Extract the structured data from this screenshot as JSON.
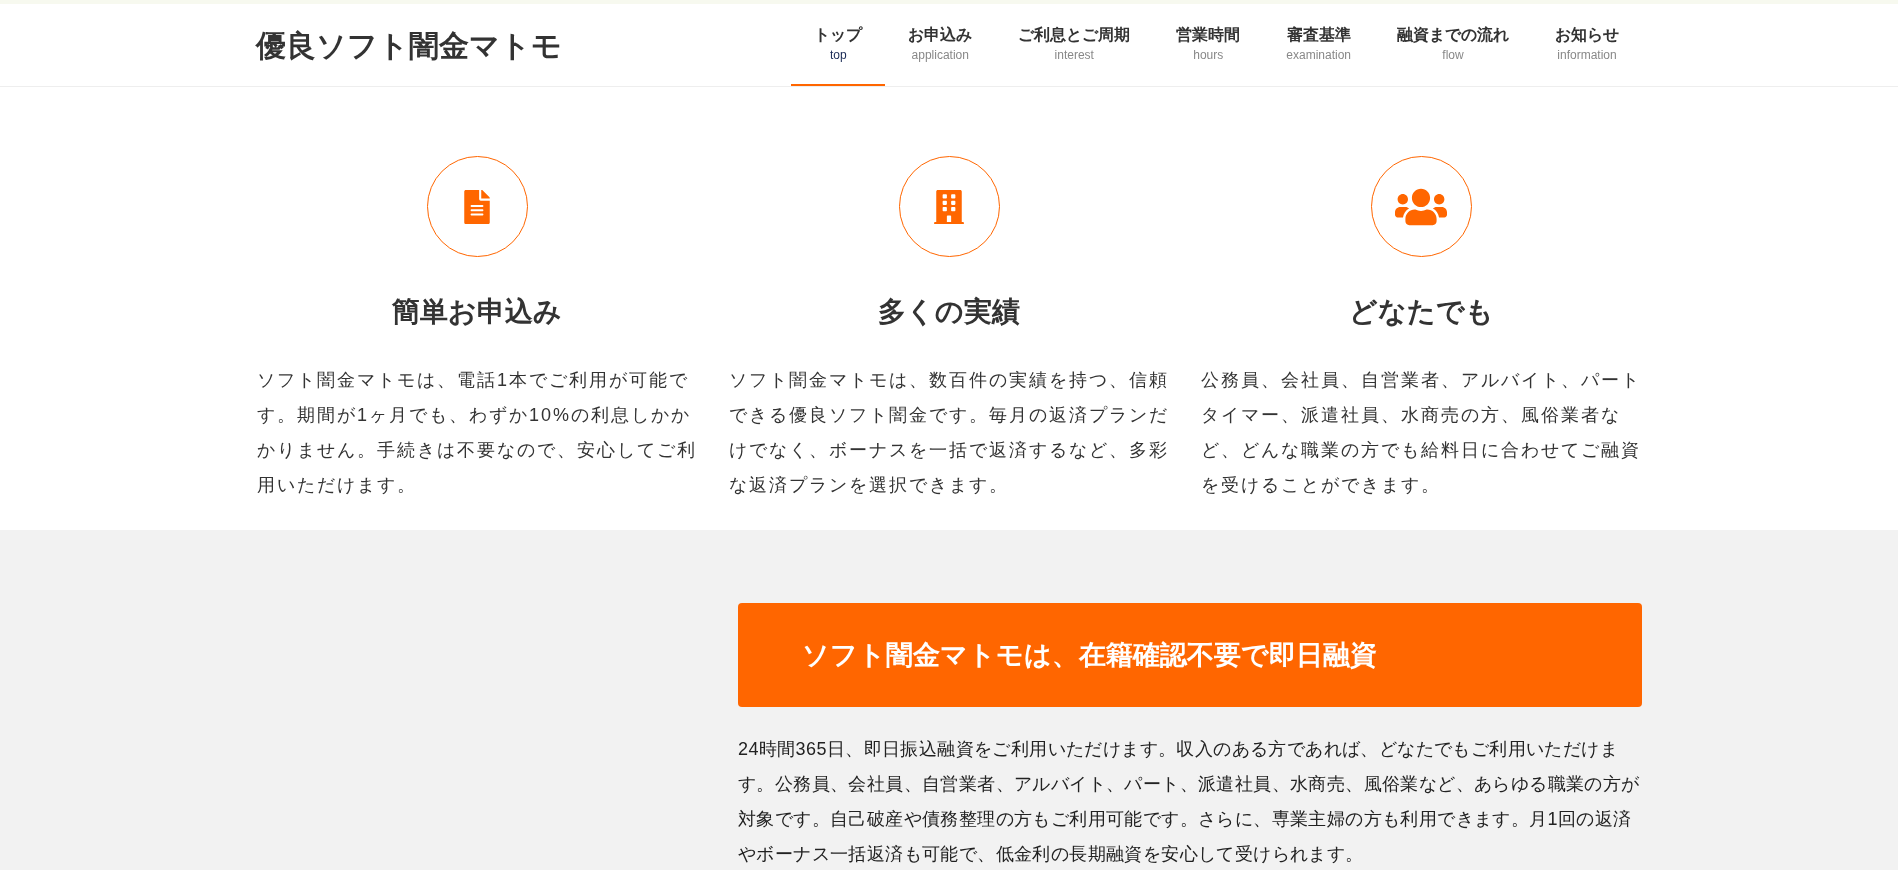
{
  "header": {
    "logo": "優良ソフト闇金マトモ",
    "nav": [
      {
        "label": "トップ",
        "sub": "top",
        "selected": true
      },
      {
        "label": "お申込み",
        "sub": "application",
        "selected": false
      },
      {
        "label": "ご利息とご周期",
        "sub": "interest",
        "selected": false
      },
      {
        "label": "営業時間",
        "sub": "hours",
        "selected": false
      },
      {
        "label": "審査基準",
        "sub": "examination",
        "selected": false
      },
      {
        "label": "融資までの流れ",
        "sub": "flow",
        "selected": false
      },
      {
        "label": "お知らせ",
        "sub": "information",
        "selected": false
      }
    ]
  },
  "features": [
    {
      "kind": "document",
      "title": "簡単お申込み",
      "text": "ソフト闇金マトモは、電話1本でご利用が可能です。期間が1ヶ月でも、わずか10%の利息しかかかりません。手続きは不要なので、安心してご利用いただけます。"
    },
    {
      "kind": "building",
      "title": "多くの実績",
      "text": "ソフト闇金マトモは、数百件の実績を持つ、信頼できる優良ソフト闇金です。毎月の返済プランだけでなく、ボーナスを一括で返済するなど、多彩な返済プランを選択できます。"
    },
    {
      "kind": "people",
      "title": "どなたでも",
      "text": "公務員、会社員、自営業者、アルバイト、パートタイマー、派遣社員、水商売の方、風俗業者など、どんな職業の方でも給料日に合わせてご融資を受けることができます。"
    }
  ],
  "section": {
    "heading": "ソフト闇金マトモは、在籍確認不要で即日融資",
    "text": "24時間365日、即日振込融資をご利用いただけます。収入のある方であれば、どなたでもご利用いただけます。公務員、会社員、自営業者、アルバイト、パート、派遣社員、水商売、風俗業など、あらゆる職業の方が対象です。自己破産や債務整理の方もご利用可能です。さらに、専業主婦の方も利用できます。月1回の返済やボーナス一括返済も可能で、低金利の長期融資を安心して受けられます。"
  }
}
